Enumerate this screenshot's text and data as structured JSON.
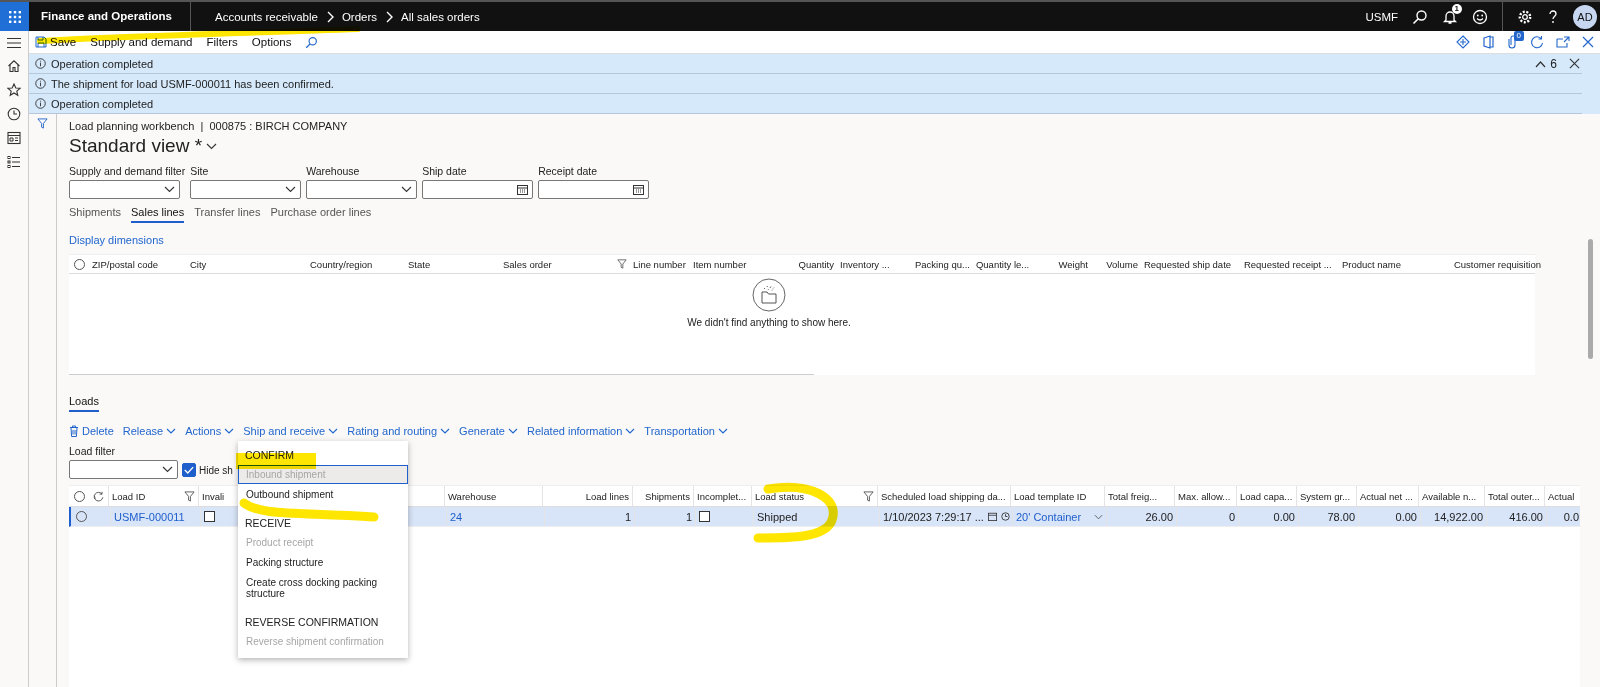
{
  "app_bar": {
    "app_name": "Finance and Operations",
    "breadcrumbs": [
      "Accounts receivable",
      "Orders",
      "All sales orders"
    ],
    "company": "USMF",
    "notification_count": "1",
    "avatar": "AD"
  },
  "action_bar": {
    "items": [
      "Save",
      "Supply and demand",
      "Filters",
      "Options"
    ],
    "attachment_count": "0"
  },
  "messages": {
    "items": [
      "Operation completed",
      "The shipment for load USMF-000011 has been confirmed.",
      "Operation completed"
    ],
    "count": "6"
  },
  "page": {
    "caption": "Load planning workbench  |  000875 : BIRCH COMPANY",
    "view_name": "Standard view *"
  },
  "filters": [
    {
      "label": "Supply and demand filter",
      "kind": "dropdown"
    },
    {
      "label": "Site",
      "kind": "dropdown"
    },
    {
      "label": "Warehouse",
      "kind": "dropdown"
    },
    {
      "label": "Ship date",
      "kind": "date"
    },
    {
      "label": "Receipt date",
      "kind": "date"
    }
  ],
  "tabs": [
    {
      "label": "Shipments",
      "selected": false
    },
    {
      "label": "Sales lines",
      "selected": true
    },
    {
      "label": "Transfer lines",
      "selected": false
    },
    {
      "label": "Purchase order lines",
      "selected": false
    }
  ],
  "display_dimensions": "Display dimensions",
  "lines_grid": {
    "columns": [
      {
        "label": "ZIP/postal code",
        "filtered": false
      },
      {
        "label": "City",
        "filtered": false
      },
      {
        "label": "Country/region",
        "filtered": false
      },
      {
        "label": "State",
        "filtered": false
      },
      {
        "label": "Sales order",
        "filtered": true
      },
      {
        "label": "Line number",
        "filtered": false
      },
      {
        "label": "Item number",
        "filtered": false
      },
      {
        "label": "Quantity",
        "filtered": false
      },
      {
        "label": "Inventory ...",
        "filtered": false
      },
      {
        "label": "Packing qu...",
        "filtered": false
      },
      {
        "label": "Quantity le...",
        "filtered": false
      },
      {
        "label": "Weight",
        "filtered": false
      },
      {
        "label": "Volume",
        "filtered": false
      },
      {
        "label": "Requested ship date",
        "filtered": false
      },
      {
        "label": "Requested receipt ...",
        "filtered": false
      },
      {
        "label": "Product name",
        "filtered": false
      },
      {
        "label": "Customer requisition",
        "filtered": false
      }
    ],
    "select_all": false,
    "empty_message": "We didn't find anything to show here."
  },
  "loads_section": {
    "tab": {
      "label": "Loads",
      "selected": true
    },
    "toolbar": [
      {
        "label": "Delete",
        "kind": "delete"
      },
      {
        "label": "Release",
        "kind": "menu"
      },
      {
        "label": "Actions",
        "kind": "menu"
      },
      {
        "label": "Ship and receive",
        "kind": "menu"
      },
      {
        "label": "Rating and routing",
        "kind": "menu"
      },
      {
        "label": "Generate",
        "kind": "menu"
      },
      {
        "label": "Related information",
        "kind": "menu"
      },
      {
        "label": "Transportation",
        "kind": "menu"
      }
    ],
    "load_filter": {
      "label": "Load filter"
    },
    "hide_checkbox": {
      "label": "Hide sh",
      "checked": true
    }
  },
  "loads_grid": {
    "columns": [
      {
        "label": "Load ID",
        "filtered": true
      },
      {
        "label": "Invali",
        "filtered": false
      },
      {
        "label": "Warehouse",
        "filtered": false
      },
      {
        "label": "Load lines",
        "filtered": false
      },
      {
        "label": "Shipments",
        "filtered": false
      },
      {
        "label": "Incomplet...",
        "filtered": false
      },
      {
        "label": "Load status",
        "filtered": true
      },
      {
        "label": "Scheduled load shipping da...",
        "filtered": false
      },
      {
        "label": "Load template ID",
        "filtered": false
      },
      {
        "label": "Total freig...",
        "filtered": false
      },
      {
        "label": "Max. allow...",
        "filtered": false
      },
      {
        "label": "Load capa...",
        "filtered": false
      },
      {
        "label": "System gr...",
        "filtered": false
      },
      {
        "label": "Actual net ...",
        "filtered": false
      },
      {
        "label": "Available n...",
        "filtered": false
      },
      {
        "label": "Total outer...",
        "filtered": false
      },
      {
        "label": "Actual",
        "filtered": false
      }
    ],
    "select_all": false,
    "rows": [
      {
        "selected": true,
        "cells": [
          {
            "kind": "link",
            "text": "USMF-000011"
          },
          {
            "kind": "checkbox",
            "checked": false
          },
          {
            "kind": "link",
            "text": "24"
          },
          {
            "kind": "text",
            "text": "1"
          },
          {
            "kind": "text",
            "text": "1"
          },
          {
            "kind": "checkbox",
            "checked": false
          },
          {
            "kind": "text",
            "text": "Shipped"
          },
          {
            "kind": "datetime",
            "text": "1/10/2023 7:29:17 ..."
          },
          {
            "kind": "lookup",
            "text": "20' Container"
          },
          {
            "kind": "text",
            "text": "26.00"
          },
          {
            "kind": "text",
            "text": "0"
          },
          {
            "kind": "text",
            "text": "0.00"
          },
          {
            "kind": "text",
            "text": "78.00"
          },
          {
            "kind": "text",
            "text": "0.00"
          },
          {
            "kind": "text",
            "text": "14,922.00"
          },
          {
            "kind": "text",
            "text": "416.00"
          },
          {
            "kind": "text",
            "text": "0.0"
          }
        ]
      }
    ]
  },
  "menu": {
    "sections": [
      {
        "heading": "CONFIRM",
        "items": [
          {
            "label": "Inbound shipment",
            "disabled": true,
            "focused": true
          },
          {
            "label": "Outbound shipment",
            "disabled": false,
            "focused": false
          }
        ]
      },
      {
        "heading": "RECEIVE",
        "items": [
          {
            "label": "Product receipt",
            "disabled": true,
            "focused": false
          },
          {
            "label": "Packing structure",
            "disabled": false,
            "focused": false
          },
          {
            "label": "Create cross docking packing structure",
            "disabled": false,
            "focused": false
          }
        ]
      },
      {
        "heading": "REVERSE CONFIRMATION",
        "items": [
          {
            "label": "Reverse shipment confirmation",
            "disabled": true,
            "focused": false
          }
        ]
      }
    ]
  }
}
